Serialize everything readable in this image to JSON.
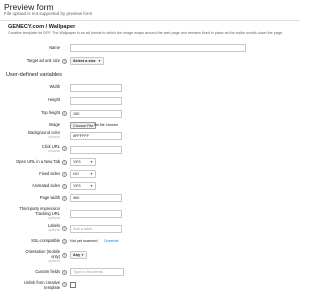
{
  "header": {
    "title": "Preview form",
    "subtitle": "File upload is not supported by preview form"
  },
  "template": {
    "name": "GENECY.com / Wallpaper",
    "description": "Creative template for DFP. The Wallpaper is an ad format to which the image wraps around the web page and remains fixed in place as the visitor scrolls down the page."
  },
  "fields": {
    "name_label": "Name",
    "size_label": "Target ad unit size",
    "size_value": "Select a size"
  },
  "variables": {
    "section_title": "User-defined variables",
    "optional": "optional",
    "width_label": "Width",
    "height_label": "Height",
    "top_height_label": "Top height",
    "top_height_value": "150",
    "image_label": "Image",
    "choose_file": "Choose File",
    "no_file": "No file chosen",
    "bg_color_label": "Background color",
    "bg_color_value": "#FFFFFF",
    "click_url_label": "Click URL",
    "open_url_label": "Open URL in a New Tab",
    "open_url_value": "YES",
    "fixed_sides_label": "Fixed sides",
    "fixed_sides_value": "NO",
    "animated_sides_label": "Animated sides",
    "animated_sides_value": "YES",
    "page_width_label": "Page width",
    "page_width_value": "960",
    "third_party_label_1": "Third-party impression",
    "third_party_label_2": "Tracking URL",
    "labels_label": "Labels",
    "labels_placeholder": "Add a label",
    "ssl_label": "SSL-compatible",
    "ssl_status": "Not yet scanned",
    "ssl_override": "Override",
    "orientation_label_1": "Orientation (mobile",
    "orientation_label_2": "only)",
    "orientation_value": "Any",
    "custom_fields_label": "Custom fields",
    "custom_fields_placeholder": "Type to find items",
    "unlink_label_1": "Unlink from creative",
    "unlink_label_2": "template"
  }
}
